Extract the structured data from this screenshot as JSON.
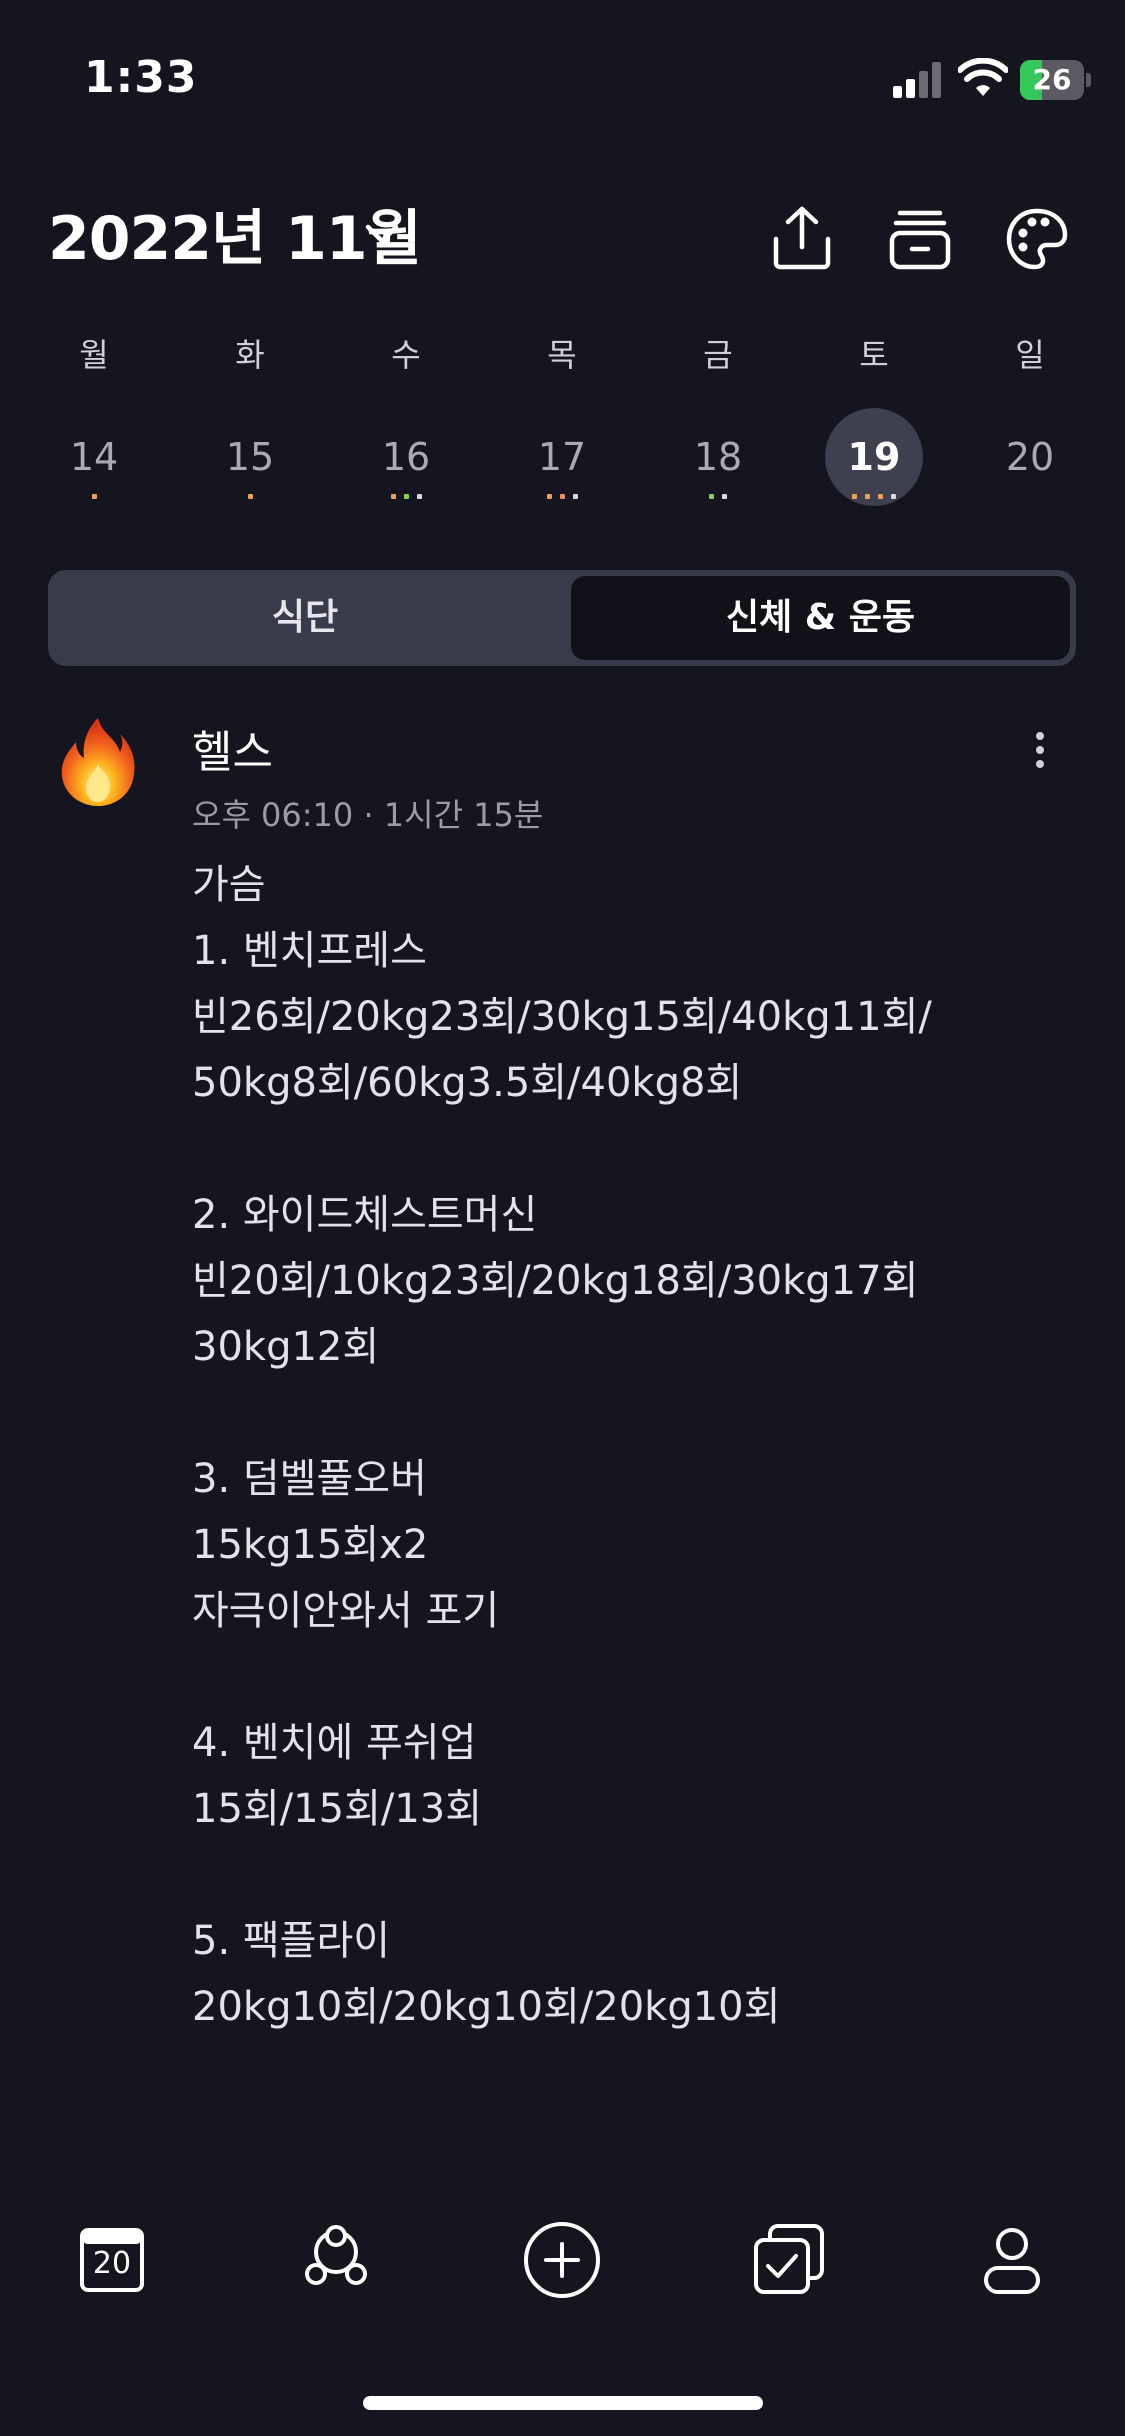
{
  "status": {
    "time": "1:33",
    "battery": "26"
  },
  "header": {
    "month": "2022년 11월"
  },
  "week": [
    {
      "dow": "월",
      "day": "14",
      "selected": false,
      "dots": [
        "#e8a35a"
      ]
    },
    {
      "dow": "화",
      "day": "15",
      "selected": false,
      "dots": [
        "#e8a35a"
      ]
    },
    {
      "dow": "수",
      "day": "16",
      "selected": false,
      "dots": [
        "#e8a35a",
        "#8fd14f",
        "#d9d9e0"
      ]
    },
    {
      "dow": "목",
      "day": "17",
      "selected": false,
      "dots": [
        "#e8a35a",
        "#f08a6c",
        "#d9d9e0"
      ]
    },
    {
      "dow": "금",
      "day": "18",
      "selected": false,
      "dots": [
        "#8fd14f",
        "#d9d9e0"
      ]
    },
    {
      "dow": "토",
      "day": "19",
      "selected": true,
      "dots": [
        "#e8a35a",
        "#e8a35a",
        "#e8a35a",
        "#d9d9e0"
      ]
    },
    {
      "dow": "일",
      "day": "20",
      "selected": false,
      "dots": []
    }
  ],
  "tabs": {
    "diet": "식단",
    "body_exercise": "신체 & 운동",
    "active": "body_exercise"
  },
  "entry": {
    "icon": "fire-icon",
    "title": "헬스",
    "meta": "오후 06:10 · 1시간 15분",
    "body": "가슴\n1. 벤치프레스\n빈26회/20kg23회/30kg15회/40kg11회/\n50kg8회/60kg3.5회/40kg8회\n\n2. 와이드체스트머신\n빈20회/10kg23회/20kg18회/30kg17회\n30kg12회\n\n3. 덤벨풀오버\n15kg15회x2\n자극이안와서 포기\n\n4. 벤치에 푸쉬업\n15회/15회/13회\n\n5. 팩플라이\n20kg10회/20kg10회/20kg10회"
  },
  "tabbar": {
    "calendar_day": "20"
  },
  "colors": {
    "background": "#15151f",
    "segment": "#3a3b4a",
    "selected_day": "#3e3f4f"
  }
}
